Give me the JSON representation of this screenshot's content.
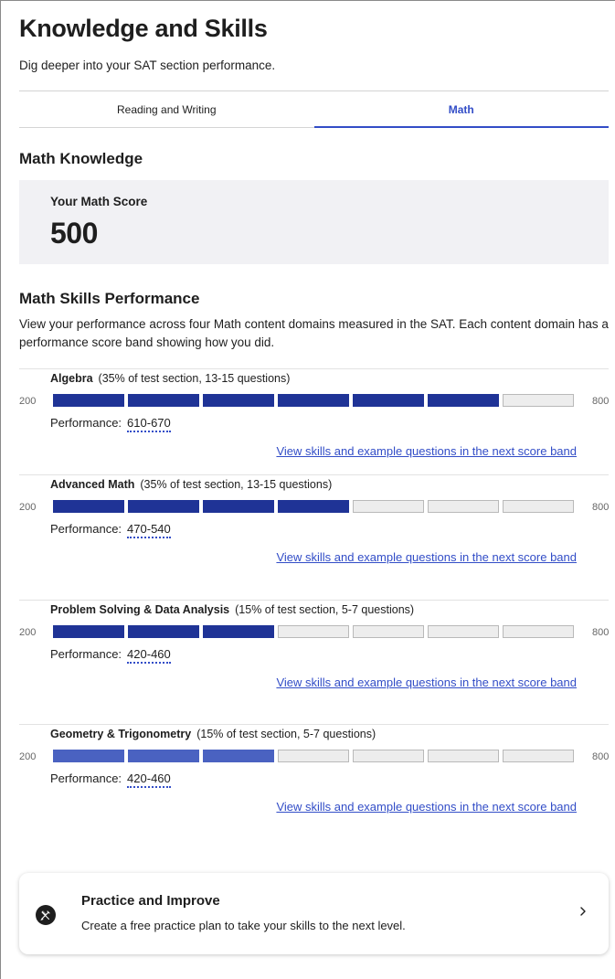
{
  "header": {
    "title": "Knowledge and Skills",
    "subtitle": "Dig deeper into your SAT section performance."
  },
  "tabs": [
    {
      "label": "Reading and Writing",
      "active": false
    },
    {
      "label": "Math",
      "active": true
    }
  ],
  "knowledge": {
    "title": "Math Knowledge",
    "score_label": "Your Math Score",
    "score_value": "500"
  },
  "skills": {
    "title": "Math Skills Performance",
    "description": "View your performance across four Math content domains measured in the SAT. Each content domain has a performance score band showing how you did.",
    "scale_min": "200",
    "scale_max": "800",
    "performance_label": "Performance:",
    "link_text": "View skills and example questions in the next score band",
    "total_segments": 7,
    "domains": [
      {
        "name": "Algebra",
        "meta": "(35% of test section, 13-15 questions)",
        "range": "610-670",
        "filled_segments": 6,
        "bar_color": "#1f3396"
      },
      {
        "name": "Advanced Math",
        "meta": "(35% of test section, 13-15 questions)",
        "range": "470-540",
        "filled_segments": 4,
        "bar_color": "#1f3396"
      },
      {
        "name": "Problem Solving & Data Analysis",
        "meta": "(15% of test section, 5-7 questions)",
        "range": "420-460",
        "filled_segments": 3,
        "bar_color": "#1f3396"
      },
      {
        "name": "Geometry & Trigonometry",
        "meta": "(15% of test section, 5-7 questions)",
        "range": "420-460",
        "filled_segments": 3,
        "bar_color": "#4a62c1"
      }
    ]
  },
  "practice": {
    "title": "Practice and Improve",
    "description": "Create a free practice plan to take your skills to the next level.",
    "icon": "pencil-ruler-icon",
    "chevron": "chevron-right-icon"
  },
  "colors": {
    "accent": "#324dc7",
    "bar_filled": "#1f3396",
    "bar_empty": "#ededed",
    "card_bg": "#f1f1f4"
  }
}
